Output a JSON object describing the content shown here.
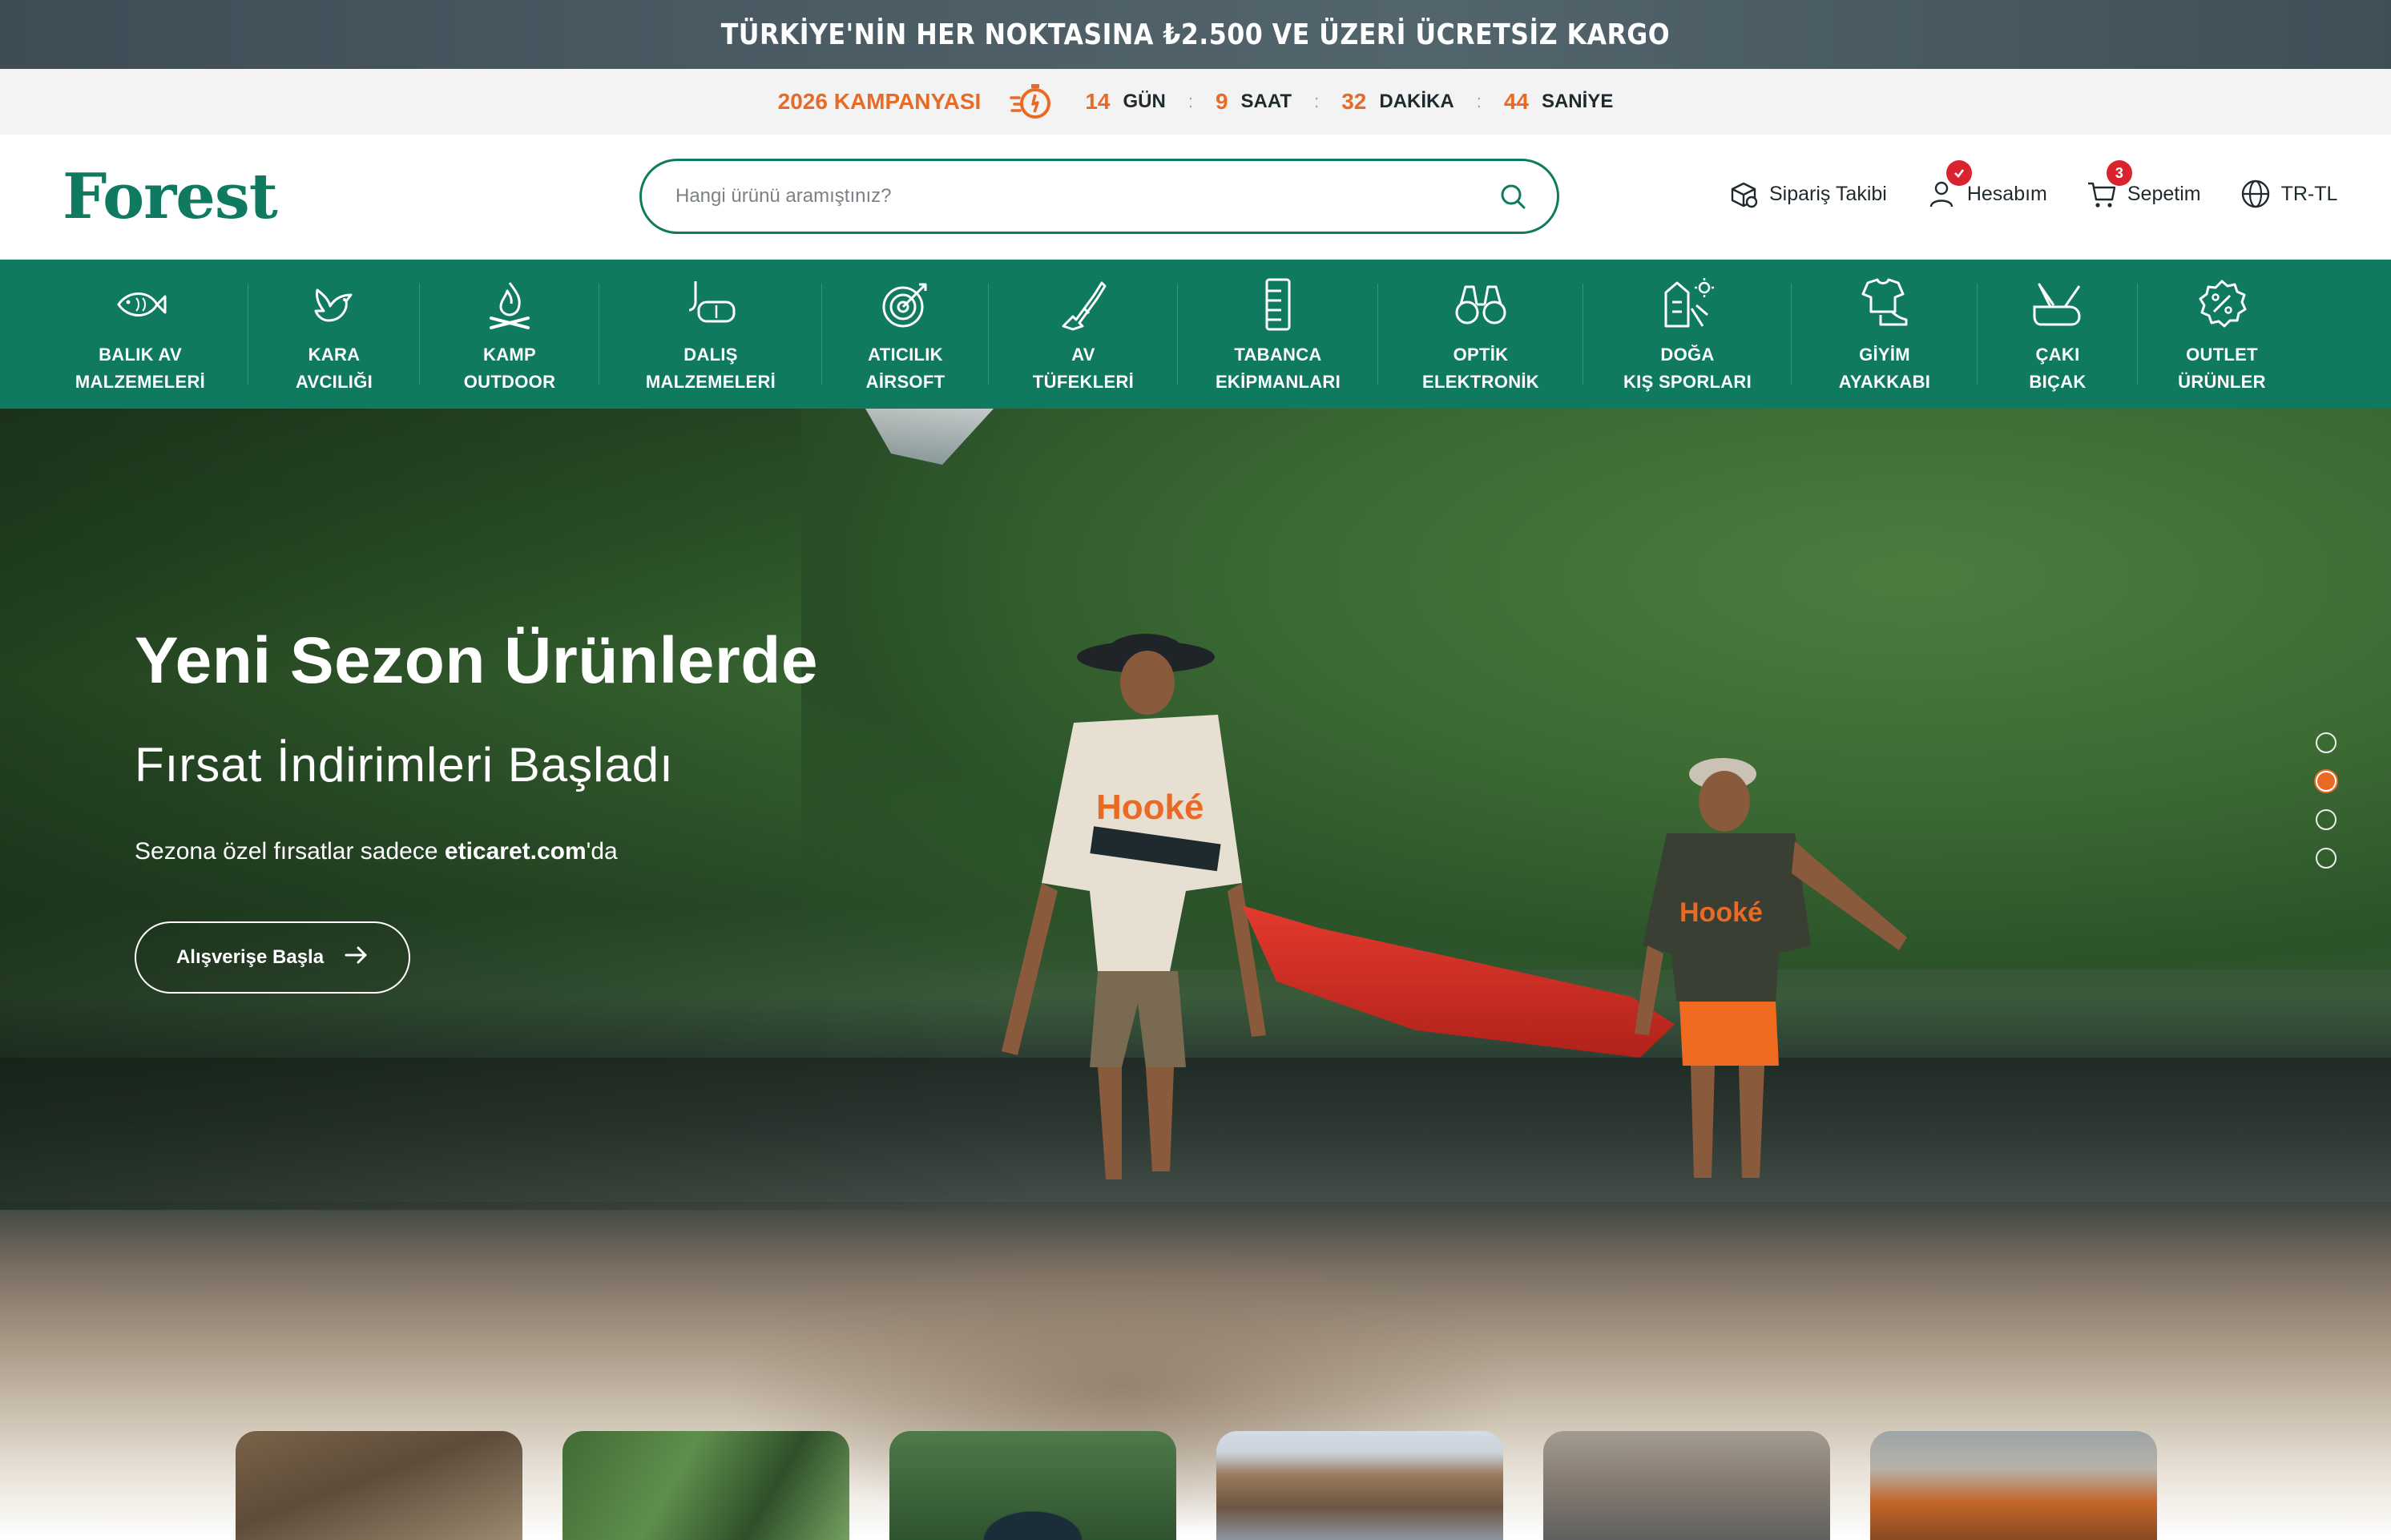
{
  "top_banner": {
    "text": "TÜRKİYE'NİN HER NOKTASINA ₺2.500 VE ÜZERİ ÜCRETSİZ KARGO"
  },
  "countdown": {
    "campaign": "2026 KAMPANYASI",
    "icon": "stopwatch-icon",
    "days": "14",
    "days_label": "GÜN",
    "hours": "9",
    "hours_label": "SAAT",
    "minutes": "32",
    "minutes_label": "DAKİKA",
    "seconds": "44",
    "seconds_label": "SANİYE",
    "separator": ":"
  },
  "header": {
    "logo": "Forest",
    "search_placeholder": "Hangi ürünü aramıştınız?",
    "actions": {
      "order_tracking": "Sipariş Takibi",
      "account": "Hesabım",
      "cart": "Sepetim",
      "cart_count": "3",
      "locale": "TR-TL"
    }
  },
  "categories": [
    {
      "line1": "BALIK AV",
      "line2": "MALZEMELERİ",
      "icon": "fish-icon"
    },
    {
      "line1": "KARA",
      "line2": "AVCILIĞI",
      "icon": "bird-icon"
    },
    {
      "line1": "KAMP",
      "line2": "OUTDOOR",
      "icon": "campfire-icon"
    },
    {
      "line1": "DALIŞ",
      "line2": "MALZEMELERİ",
      "icon": "diving-mask-icon"
    },
    {
      "line1": "ATICILIK",
      "line2": "AİRSOFT",
      "icon": "target-icon"
    },
    {
      "line1": "AV",
      "line2": "TÜFEKLERİ",
      "icon": "rifle-icon"
    },
    {
      "line1": "TABANCA",
      "line2": "EKİPMANLARI",
      "icon": "magazine-icon"
    },
    {
      "line1": "OPTİK",
      "line2": "ELEKTRONİK",
      "icon": "binoculars-icon"
    },
    {
      "line1": "DOĞA",
      "line2": "KIŞ SPORLARI",
      "icon": "skier-icon"
    },
    {
      "line1": "GİYİM",
      "line2": "AYAKKABI",
      "icon": "shirt-shoe-icon"
    },
    {
      "line1": "ÇAKI",
      "line2": "BIÇAK",
      "icon": "pocket-knife-icon"
    },
    {
      "line1": "OUTLET",
      "line2": "ÜRÜNLER",
      "icon": "percent-badge-icon"
    }
  ],
  "hero": {
    "title": "Yeni Sezon Ürünlerde",
    "subtitle": "Fırsat İndirimleri Başladı",
    "desc_prefix": "Sezona özel fırsatlar sadece ",
    "desc_brand": "eticaret.com",
    "desc_suffix": "'da",
    "cta": "Alışverişe Başla",
    "slides_total": 4,
    "active_slide": 2
  },
  "colors": {
    "brand_green": "#0f7a60",
    "accent_orange": "#e86a25",
    "badge_red": "#d9232e"
  }
}
